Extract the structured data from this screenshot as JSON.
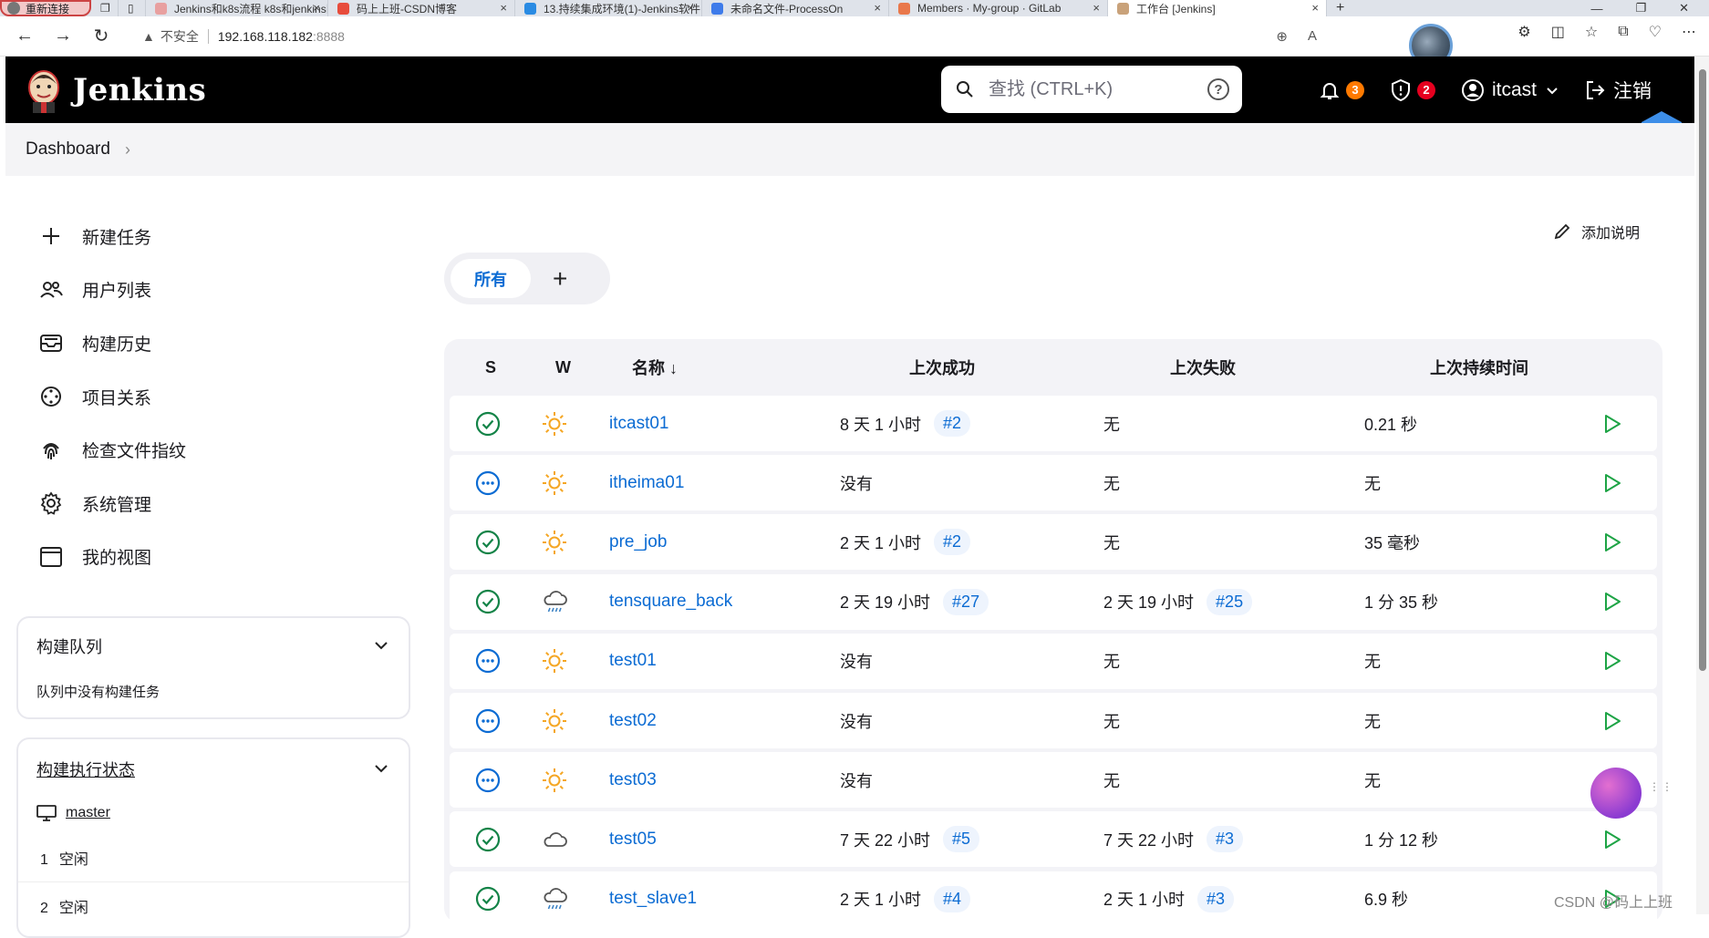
{
  "browser": {
    "reconnect_label": "重新连接",
    "tabs": [
      {
        "label": "Jenkins和k8s流程 k8s和jenkins区",
        "color": "#e8a0a0"
      },
      {
        "label": "码上上班-CSDN博客",
        "color": "#e74c3c"
      },
      {
        "label": "13.持续集成环境(1)-Jenkins软件",
        "color": "#2a8be3"
      },
      {
        "label": "未命名文件-ProcessOn",
        "color": "#3e7bea"
      },
      {
        "label": "Members · My-group · GitLab",
        "color": "#e9784b"
      },
      {
        "label": "工作台 [Jenkins]",
        "color": "#c9a27a"
      }
    ],
    "new_tab": "+",
    "insecure_label": "不安全",
    "url_host": "192.168.118.182",
    "url_port": ":8888"
  },
  "header": {
    "title": "Jenkins",
    "search_placeholder": "查找 (CTRL+K)",
    "help": "?",
    "notifications_count": "3",
    "security_count": "2",
    "user": "itcast",
    "logout": "注销"
  },
  "breadcrumb": {
    "root": "Dashboard"
  },
  "side": {
    "tasks": [
      {
        "label": "新建任务",
        "icon": "plus-icon"
      },
      {
        "label": "用户列表",
        "icon": "people-icon"
      },
      {
        "label": "构建历史",
        "icon": "inbox-icon"
      },
      {
        "label": "项目关系",
        "icon": "relationship-icon"
      },
      {
        "label": "检查文件指纹",
        "icon": "fingerprint-icon"
      },
      {
        "label": "系统管理",
        "icon": "gear-icon"
      },
      {
        "label": "我的视图",
        "icon": "window-icon"
      }
    ],
    "queue": {
      "title": "构建队列",
      "empty": "队列中没有构建任务"
    },
    "executors": {
      "title": "构建执行状态",
      "node": "master",
      "rows": [
        {
          "num": "1",
          "status": "空闲"
        },
        {
          "num": "2",
          "status": "空闲"
        }
      ]
    }
  },
  "main": {
    "add_description": "添加说明",
    "view_tab_all": "所有",
    "view_tab_add": "+",
    "columns": {
      "s": "S",
      "w": "W",
      "name": "名称 ↓",
      "last_success": "上次成功",
      "last_failure": "上次失败",
      "last_duration": "上次持续时间"
    },
    "jobs": [
      {
        "status": "success",
        "weather": "sunny",
        "name": "itcast01",
        "succ": "8 天 1 小时",
        "succ_build": "#2",
        "fail": "无",
        "fail_build": "",
        "duration": "0.21 秒"
      },
      {
        "status": "notbuilt",
        "weather": "sunny",
        "name": "itheima01",
        "succ": "没有",
        "succ_build": "",
        "fail": "无",
        "fail_build": "",
        "duration": "无"
      },
      {
        "status": "success",
        "weather": "sunny",
        "name": "pre_job",
        "succ": "2 天 1 小时",
        "succ_build": "#2",
        "fail": "无",
        "fail_build": "",
        "duration": "35 毫秒"
      },
      {
        "status": "success",
        "weather": "rain",
        "name": "tensquare_back",
        "succ": "2 天 19 小时",
        "succ_build": "#27",
        "fail": "2 天 19 小时",
        "fail_build": "#25",
        "duration": "1 分 35 秒"
      },
      {
        "status": "notbuilt",
        "weather": "sunny",
        "name": "test01",
        "succ": "没有",
        "succ_build": "",
        "fail": "无",
        "fail_build": "",
        "duration": "无"
      },
      {
        "status": "notbuilt",
        "weather": "sunny",
        "name": "test02",
        "succ": "没有",
        "succ_build": "",
        "fail": "无",
        "fail_build": "",
        "duration": "无"
      },
      {
        "status": "notbuilt",
        "weather": "sunny",
        "name": "test03",
        "succ": "没有",
        "succ_build": "",
        "fail": "无",
        "fail_build": "",
        "duration": "无"
      },
      {
        "status": "success",
        "weather": "cloudy",
        "name": "test05",
        "succ": "7 天 22 小时",
        "succ_build": "#5",
        "fail": "7 天 22 小时",
        "fail_build": "#3",
        "duration": "1 分 12 秒"
      },
      {
        "status": "success",
        "weather": "rain",
        "name": "test_slave1",
        "succ": "2 天 1 小时",
        "succ_build": "#4",
        "fail": "2 天 1 小时",
        "fail_build": "#3",
        "duration": "6.9 秒"
      }
    ]
  },
  "watermark": "CSDN @码上上班",
  "colors": {
    "accent": "#0b6bd3",
    "success": "#138347",
    "notbuilt": "#0b6bd3",
    "sunny": "#f5a623",
    "run": "#1ea446"
  }
}
